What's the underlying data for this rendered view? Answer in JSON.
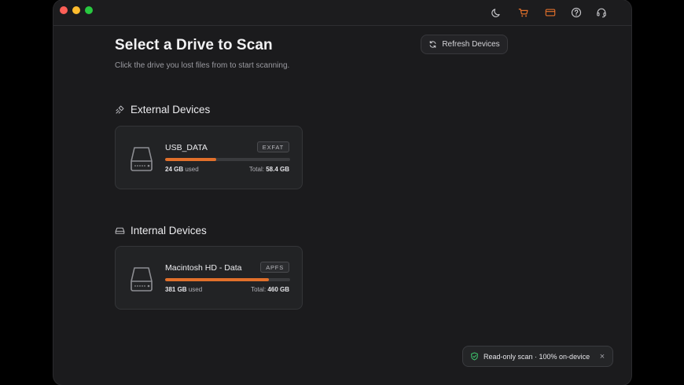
{
  "header": {
    "icons": [
      "moon-icon",
      "cart-icon",
      "card-icon",
      "help-icon",
      "support-headset-icon"
    ]
  },
  "main": {
    "title": "Select a Drive to Scan",
    "subtitle": "Click the drive you lost files from to start scanning.",
    "refresh_label": "Refresh Devices"
  },
  "sections": {
    "external": {
      "label": "External Devices",
      "drives": [
        {
          "name": "USB_DATA",
          "fs": "EXFAT",
          "used_value": "24 GB",
          "used_suffix": "used",
          "total_label": "Total:",
          "total_value": "58.4 GB",
          "usage_fraction": 0.41
        }
      ]
    },
    "internal": {
      "label": "Internal Devices",
      "drives": [
        {
          "name": "Macintosh HD - Data",
          "fs": "APFS",
          "used_value": "381 GB",
          "used_suffix": "used",
          "total_label": "Total:",
          "total_value": "460 GB",
          "usage_fraction": 0.83
        }
      ]
    }
  },
  "toast": {
    "text": "Read-only scan · 100% on-device",
    "close_label": "×"
  },
  "colors": {
    "accent": "#e2702b",
    "background": "#1b1b1d",
    "card": "#222325",
    "shield": "#3ec46d"
  }
}
